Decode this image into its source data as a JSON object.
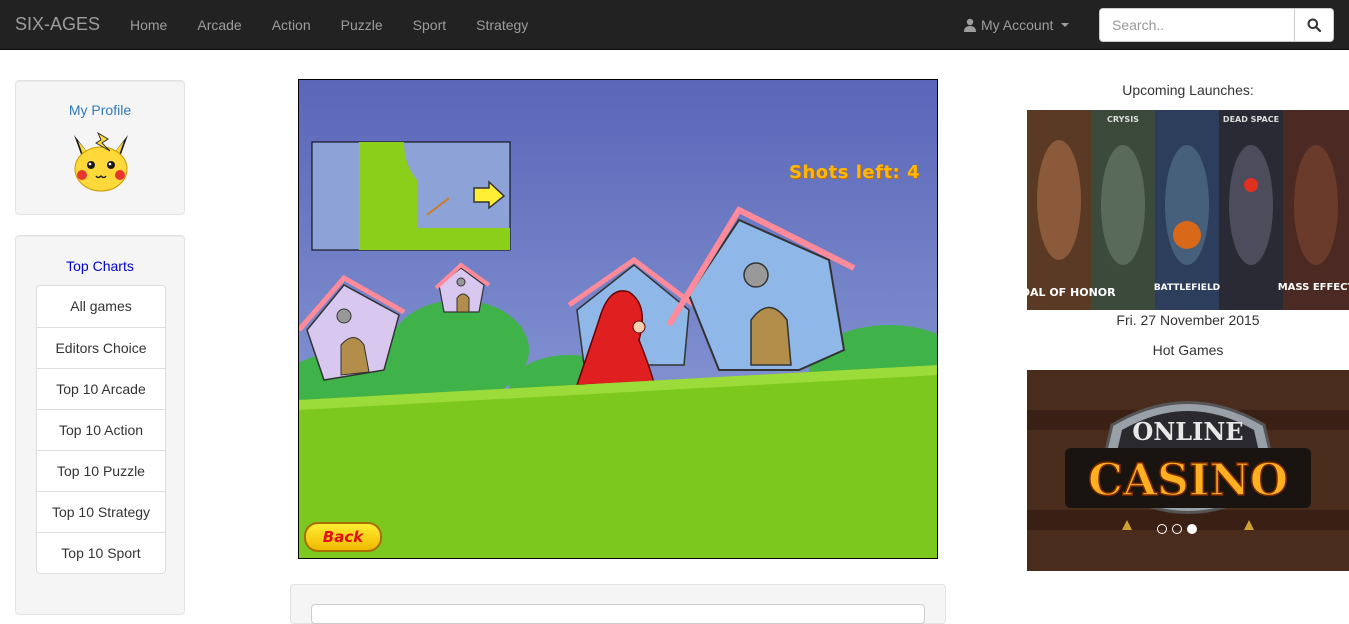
{
  "navbar": {
    "brand": "SIX-AGES",
    "links": [
      "Home",
      "Arcade",
      "Action",
      "Puzzle",
      "Sport",
      "Strategy"
    ],
    "account_label": "My Account",
    "search_placeholder": "Search.."
  },
  "sidebar": {
    "profile_title": "My Profile",
    "charts_title": "Top Charts",
    "items": [
      "All games",
      "Editors Choice",
      "Top 10 Arcade",
      "Top 10 Action",
      "Top 10 Puzzle",
      "Top 10 Strategy",
      "Top 10 Sport"
    ]
  },
  "game": {
    "shots_text": "Shots left: 4",
    "back_label": "Back"
  },
  "right": {
    "upcoming_title": "Upcoming Launches:",
    "launch_titles": [
      "MEDAL OF HONOR",
      "CRYSIS",
      "BATTLEFIELD",
      "DEAD SPACE",
      "MASS EFFECT"
    ],
    "date": "Fri. 27 November 2015",
    "hot_title": "Hot Games",
    "casino_line1": "ONLINE",
    "casino_line2": "CASINO",
    "carousel_active_index": 2,
    "carousel_count": 3
  },
  "colors": {
    "navbar_bg": "#222222",
    "link_blue": "#337ab7",
    "top_charts_blue": "#0000cc",
    "shots_orange": "#ffb800"
  }
}
